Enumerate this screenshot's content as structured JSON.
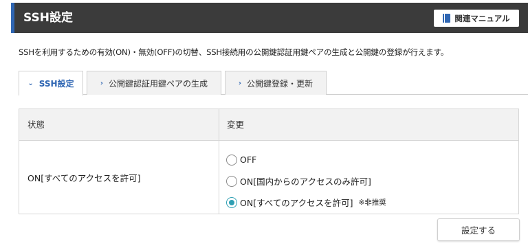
{
  "header": {
    "title": "SSH設定",
    "manual_button": "関連マニュアル",
    "manual_icon": "book-icon"
  },
  "description": "SSHを利用するための有効(ON)・無効(OFF)の切替、SSH接続用の公開鍵認証用鍵ペアの生成と公開鍵の登録が行えます。",
  "tabs": [
    {
      "label": "SSH設定",
      "icon": "chevron-down-icon",
      "active": true
    },
    {
      "label": "公開鍵認証用鍵ペアの生成",
      "icon": "chevron-right-icon",
      "active": false
    },
    {
      "label": "公開鍵登録・更新",
      "icon": "chevron-right-icon",
      "active": false
    }
  ],
  "table": {
    "headers": [
      "状態",
      "変更"
    ],
    "current_status": "ON[すべてのアクセスを許可]",
    "options": [
      {
        "label": "OFF",
        "checked": false
      },
      {
        "label": "ON[国内からのアクセスのみ許可]",
        "checked": false
      },
      {
        "label": "ON[すべてのアクセスを許可]",
        "note": "※非推奨",
        "checked": true
      }
    ]
  },
  "submit_button": "設定する",
  "colors": {
    "header_bg": "#3b3b3b",
    "accent": "#2f66b3",
    "radio_checked": "#2f9fb3"
  }
}
